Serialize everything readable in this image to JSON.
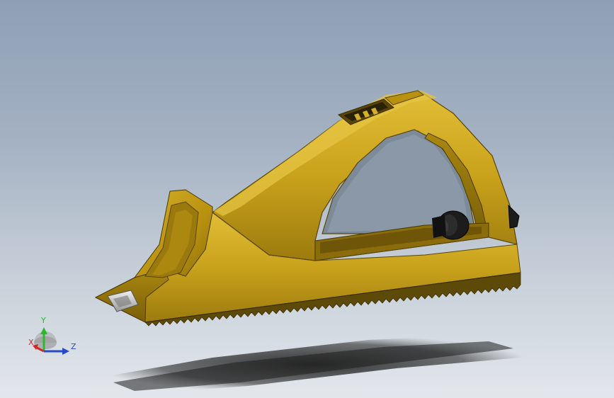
{
  "viewport": {
    "model": "Rasp Plane"
  },
  "triad": {
    "x_label": "X",
    "y_label": "Y",
    "z_label": "Z",
    "colors": {
      "x": "#cc2a2a",
      "y": "#2db82d",
      "z": "#2a49c9"
    }
  },
  "colors": {
    "body": "#c9a21b",
    "body_shadow": "#8a6c0b",
    "body_highlight": "#e8c544",
    "knob": "#1a1a1a",
    "clip": "#c8c8c8",
    "ground_shadow": "#2a2a2a"
  }
}
